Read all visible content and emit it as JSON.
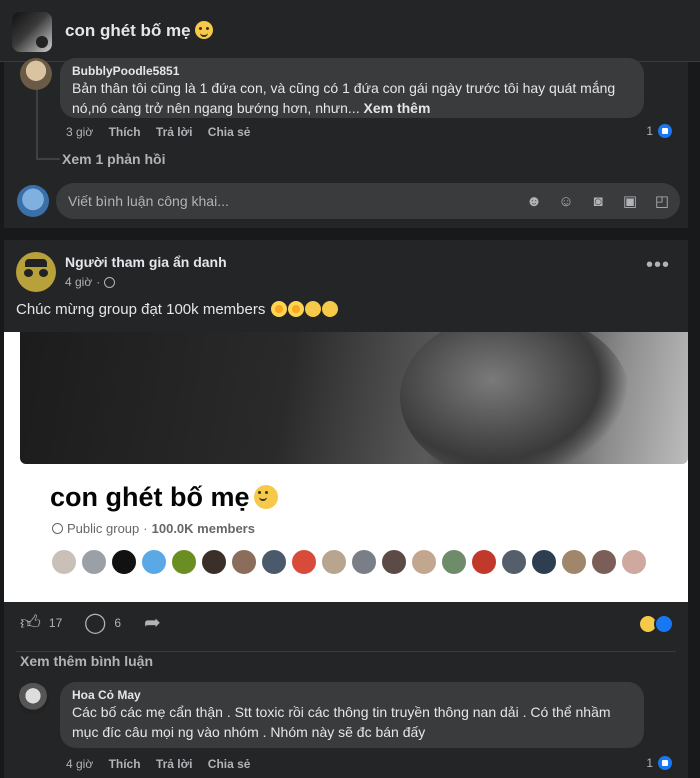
{
  "header": {
    "group_title": "con ghét bố mẹ"
  },
  "comment1": {
    "author": "BubblyPoodle5851",
    "text": "Bản thân tôi cũng là 1 đứa con, và cũng có 1 đứa con gái ngày trước tôi hay quát mắng nó,nó càng trở nên ngang bướng hơn, nhưn...",
    "see_more": "Xem thêm",
    "time": "3 giờ",
    "like": "Thích",
    "reply": "Trả lời",
    "share": "Chia sẻ",
    "reactions": "1",
    "view_replies": "Xem 1 phản hồi"
  },
  "comment_input": {
    "placeholder": "Viết bình luận công khai..."
  },
  "post": {
    "author": "Người tham gia ẩn danh",
    "time": "4 giờ",
    "text": "Chúc mừng group đạt 100k members",
    "shared_group": {
      "name": "con ghét bố mẹ",
      "type": "Public group",
      "members": "100.0K members"
    },
    "reaction_count": "17",
    "comment_count": "6",
    "more_comments": "Xem thêm bình luận"
  },
  "comment2": {
    "author": "Hoa Cỏ May",
    "text": "Các bố các mẹ cẩn thận . Stt toxic rồi các thông tin truyền thông nan dải . Có thể nhầm mục đíc câu mọi ng vào nhóm . Nhóm này sẽ đc bán đấy",
    "time": "4 giờ",
    "like": "Thích",
    "reply": "Trả lời",
    "share": "Chia sẻ",
    "reactions": "1"
  },
  "colors": {
    "accent": "#1877f2",
    "bg": "#18191a",
    "card": "#242526",
    "bubble": "#3a3b3c"
  },
  "icons": [
    "emoji-icon",
    "camera-icon",
    "gif-icon",
    "sticker-icon",
    "globe-icon",
    "more-icon",
    "like-icon",
    "comment-icon",
    "share-icon"
  ]
}
